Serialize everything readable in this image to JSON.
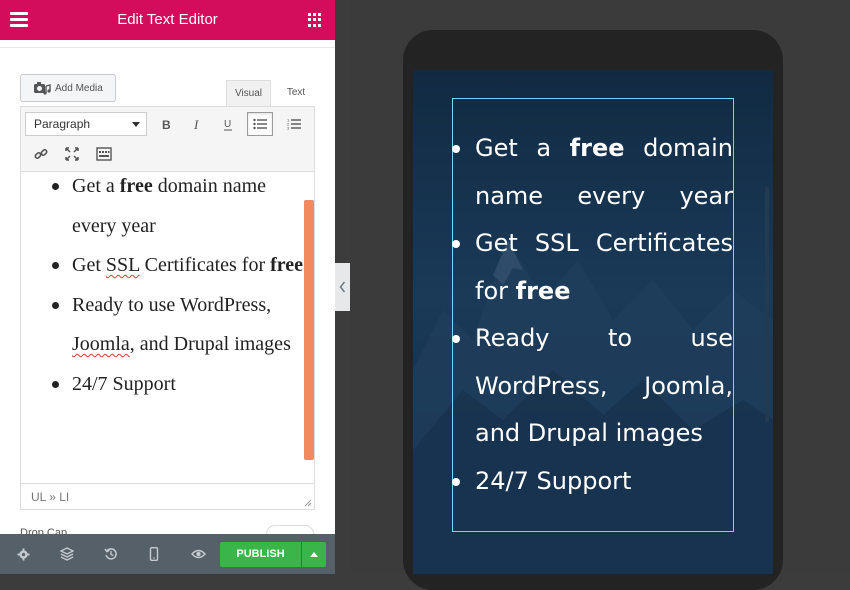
{
  "header": {
    "title": "Edit Text Editor",
    "menu_icon": "hamburger-icon",
    "apps_icon": "grid-icon",
    "color": "#d30c5c"
  },
  "media": {
    "add_media_label": "Add Media",
    "icon": "camera-music-icon"
  },
  "editor_tabs": {
    "visual": "Visual",
    "text": "Text",
    "active": "Visual"
  },
  "toolbar": {
    "format_value": "Paragraph",
    "buttons": [
      "bold-icon",
      "italic-icon",
      "underline-icon",
      "bullet-list-icon",
      "numbered-list-icon",
      "link-icon",
      "fullscreen-icon",
      "toolbar-toggle-icon"
    ],
    "active_button": "bullet-list-icon"
  },
  "content": {
    "items": [
      {
        "before": "Get a ",
        "bold": "free",
        "after": " domain name every year"
      },
      {
        "before": "Get ",
        "spell": "SSL",
        "mid": " Certificates for ",
        "bold": "free"
      },
      {
        "line1": "Ready to use WordPress, ",
        "spell": "Joomla",
        "line2": ", and Drupal images"
      },
      {
        "text": "24/7 Support"
      }
    ]
  },
  "status": {
    "path": "UL » LI"
  },
  "drop_cap": {
    "label": "Drop Cap"
  },
  "bottom_bar": {
    "icons": [
      "settings-icon",
      "layers-icon",
      "history-icon",
      "mobile-icon",
      "preview-eye-icon"
    ],
    "publish_label": "PUBLISH",
    "publish_color": "#39b54a"
  },
  "preview": {
    "items": [
      {
        "before": "Get a ",
        "bold": "free",
        "after": " domain name every year"
      },
      {
        "before": "Get SSL Certificates for ",
        "bold": "free"
      },
      {
        "text": "Ready to use WordPress, Joomla, and Drupal images"
      },
      {
        "text": "24/7 Support"
      }
    ],
    "background_color": "#132c45",
    "widget_outline_color": "#71d7f7"
  }
}
